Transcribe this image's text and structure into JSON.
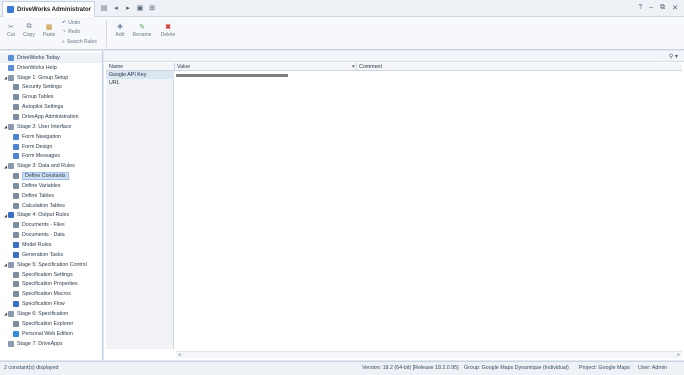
{
  "window": {
    "app_title": "DriveWorks Administrator",
    "controls": [
      "?",
      "–",
      "⧉",
      "✕"
    ]
  },
  "qat": {
    "icons": [
      "app-menu-icon",
      "back-icon",
      "forward-icon",
      "save-icon",
      "layout-icon"
    ]
  },
  "ribbon": {
    "cut": "Cut",
    "copy": "Copy",
    "paste": "Paste",
    "undo": "Undo",
    "redo": "Redo",
    "search_rules": "Search Rules",
    "add": "Add",
    "rename": "Rename",
    "delete": "Delete"
  },
  "tree": {
    "items": [
      {
        "label": "DriveWorks Today",
        "level": 0,
        "header": true,
        "icon_color": "#5a8fd8"
      },
      {
        "label": "DriveWorks Help",
        "level": 0,
        "icon_color": "#5a8fd8"
      },
      {
        "label": "Stage 1: Group Setup",
        "level": 0,
        "expanded": true,
        "icon_color": "#8a9bb0"
      },
      {
        "label": "Security Settings",
        "level": 1,
        "icon_color": "#7d8d9f"
      },
      {
        "label": "Group Tables",
        "level": 1,
        "icon_color": "#7d8d9f"
      },
      {
        "label": "Autopilot Settings",
        "level": 1,
        "icon_color": "#7d8d9f"
      },
      {
        "label": "DriveApp Administration",
        "level": 1,
        "icon_color": "#7d8d9f"
      },
      {
        "label": "Stage 2: User Interface",
        "level": 0,
        "expanded": true,
        "icon_color": "#8a9bb0"
      },
      {
        "label": "Form Navigation",
        "level": 1,
        "icon_color": "#4c84d3"
      },
      {
        "label": "Form Design",
        "level": 1,
        "icon_color": "#4c84d3"
      },
      {
        "label": "Form Messages",
        "level": 1,
        "icon_color": "#4c84d3"
      },
      {
        "label": "Stage 3: Data and Rules",
        "level": 0,
        "expanded": true,
        "icon_color": "#8a9bb0"
      },
      {
        "label": "Define Constants",
        "level": 1,
        "selected": true,
        "icon_color": "#7d8d9f"
      },
      {
        "label": "Define Variables",
        "level": 1,
        "icon_color": "#7d8d9f"
      },
      {
        "label": "Define Tables",
        "level": 1,
        "icon_color": "#7d8d9f"
      },
      {
        "label": "Calculation Tables",
        "level": 1,
        "icon_color": "#7d8d9f"
      },
      {
        "label": "Stage 4: Output Rules",
        "level": 0,
        "expanded": true,
        "icon_color": "#3a6fc4"
      },
      {
        "label": "Documents - Files",
        "level": 1,
        "icon_color": "#7d8d9f"
      },
      {
        "label": "Documents - Data",
        "level": 1,
        "icon_color": "#7d8d9f"
      },
      {
        "label": "Model Rules",
        "level": 1,
        "icon_color": "#3a6fc4"
      },
      {
        "label": "Generation Tasks",
        "level": 1,
        "icon_color": "#3a6fc4"
      },
      {
        "label": "Stage 5: Specification Control",
        "level": 0,
        "expanded": true,
        "icon_color": "#8a9bb0"
      },
      {
        "label": "Specification Settings",
        "level": 1,
        "icon_color": "#7d8d9f"
      },
      {
        "label": "Specification Properties",
        "level": 1,
        "icon_color": "#7d8d9f"
      },
      {
        "label": "Specification Macros",
        "level": 1,
        "icon_color": "#7d8d9f"
      },
      {
        "label": "Specification Flow",
        "level": 1,
        "icon_color": "#3a6fc4"
      },
      {
        "label": "Stage 6: Specification",
        "level": 0,
        "expanded": true,
        "icon_color": "#8a9bb0"
      },
      {
        "label": "Specification Explorer",
        "level": 1,
        "icon_color": "#7d8d9f"
      },
      {
        "label": "Personal Web Edition",
        "level": 1,
        "icon_color": "#2f8fd6"
      },
      {
        "label": "Stage 7: DriveApps",
        "level": 0,
        "icon_color": "#8a9bb0"
      }
    ]
  },
  "grid": {
    "columns": [
      "Name",
      "Value",
      "Comment"
    ],
    "rows": [
      {
        "name": "Google API Key",
        "value_masked": true,
        "comment": ""
      },
      {
        "name": "URL",
        "value_masked": false,
        "comment": ""
      }
    ]
  },
  "statusbar": {
    "left": "2 constant(s) displayed",
    "version": "Version: 18.2 (64-bit) [Release 18.2.0.95]",
    "group": "Group: Google Maps Dynamique (Individual)",
    "project": "Project: Google Maps",
    "user": "User: Admin"
  },
  "colors": {
    "accent": "#3a7bd5",
    "selection": "#cfe0f5"
  }
}
